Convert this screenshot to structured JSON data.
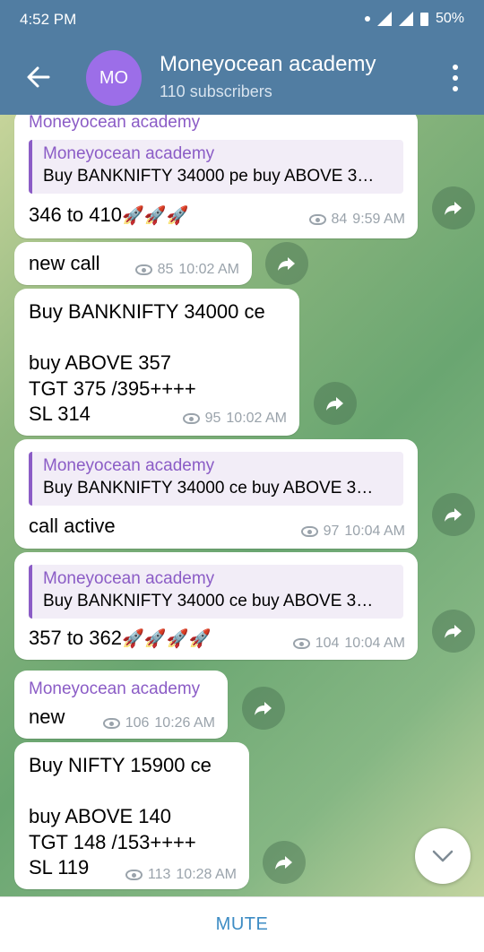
{
  "status_bar": {
    "time": "4:52 PM",
    "battery": "50%"
  },
  "header": {
    "avatar_initials": "MO",
    "title": "Moneyocean academy",
    "subtitle": "110 subscribers"
  },
  "messages": [
    {
      "sender": "Moneyocean academy",
      "reply_name": "Moneyocean academy",
      "reply_text": "Buy BANKNIFTY 34000 pe  buy ABOVE 3…",
      "text": "346 to 410",
      "rockets": "🚀🚀🚀",
      "views": "84",
      "time": "9:59 AM"
    },
    {
      "text": "new call",
      "views": "85",
      "time": "10:02 AM"
    },
    {
      "text": "Buy BANKNIFTY 34000 ce\n\nbuy ABOVE 357\nTGT 375 /395++++\nSL 314",
      "views": "95",
      "time": "10:02 AM"
    },
    {
      "reply_name": "Moneyocean academy",
      "reply_text": "Buy BANKNIFTY 34000 ce  buy ABOVE 3…",
      "text": "call active",
      "views": "97",
      "time": "10:04 AM"
    },
    {
      "reply_name": "Moneyocean academy",
      "reply_text": "Buy BANKNIFTY 34000 ce  buy ABOVE 3…",
      "text": "357 to 362",
      "rockets": "🚀🚀🚀🚀",
      "views": "104",
      "time": "10:04 AM"
    },
    {
      "sender": "Moneyocean academy",
      "text": "new",
      "views": "106",
      "time": "10:26 AM"
    },
    {
      "text": "Buy NIFTY 15900 ce\n\nbuy ABOVE 140\nTGT 148 /153++++\nSL 119",
      "views": "113",
      "time": "10:28 AM"
    }
  ],
  "footer": {
    "mute_label": "MUTE"
  },
  "colors": {
    "header": "#517da2",
    "accent_purple": "#8b5cc6",
    "mute_blue": "#3d8cc4",
    "avatar": "#9c6ee8"
  },
  "icons": {
    "back": "arrow-left-icon",
    "more": "more-vert-icon",
    "share": "share-icon",
    "scroll_down": "chevron-down-icon",
    "views": "eye-icon"
  }
}
